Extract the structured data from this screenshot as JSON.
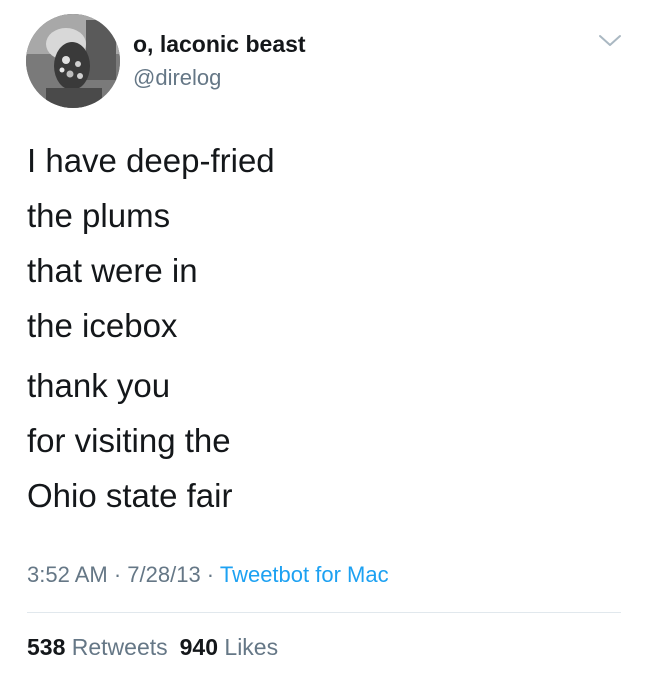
{
  "author": {
    "display_name": "o, laconic beast",
    "handle": "@direlog"
  },
  "icons": {
    "menu": "chevron-down-icon"
  },
  "tweet": {
    "paragraphs": [
      [
        "I have deep-fried",
        "the plums",
        "that were in",
        "the icebox"
      ],
      [
        "thank you",
        "for visiting the",
        "Ohio state fair"
      ]
    ]
  },
  "meta": {
    "time": "3:52 AM",
    "separator": " · ",
    "date": "7/28/13",
    "source": "Tweetbot for Mac"
  },
  "stats": {
    "retweets_count": "538",
    "retweets_label": "Retweets",
    "likes_count": "940",
    "likes_label": "Likes"
  },
  "colors": {
    "text": "#14171a",
    "secondary": "#657786",
    "link": "#1da1f2",
    "divider": "#e1e8ed"
  }
}
